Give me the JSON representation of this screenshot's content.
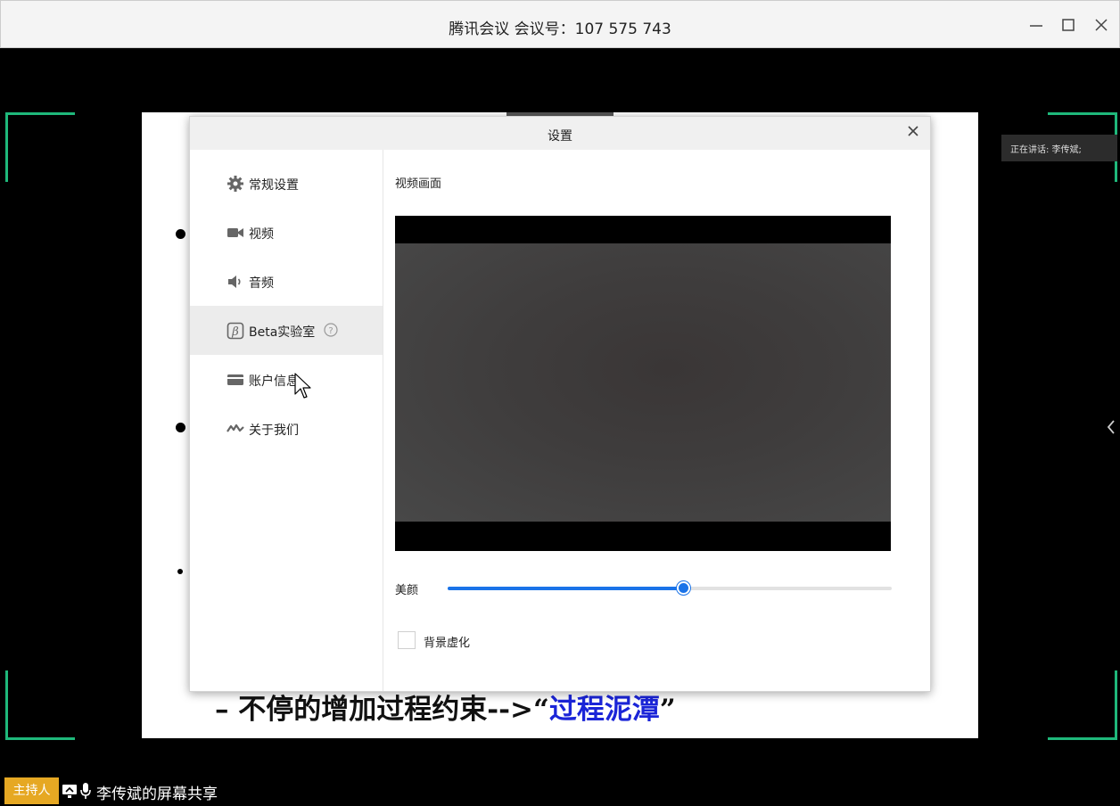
{
  "window": {
    "title": "腾讯会议 会议号：107 575 743"
  },
  "slide": {
    "line_prefix": "– 不停的增加过程约束-->“",
    "line_highlight": "过程泥潭",
    "line_suffix": "”"
  },
  "speaking": {
    "label": "正在讲话: 李传斌;"
  },
  "bottom": {
    "host_badge": "主持人",
    "share_text": "李传斌的屏幕共享"
  },
  "dialog": {
    "title": "设置",
    "nav": [
      {
        "label": "常规设置",
        "icon": "gear-icon"
      },
      {
        "label": "视频",
        "icon": "video-camera-icon"
      },
      {
        "label": "音频",
        "icon": "speaker-icon"
      },
      {
        "label": "Beta实验室",
        "icon": "beta-icon",
        "active": true
      },
      {
        "label": "账户信息",
        "icon": "card-icon"
      },
      {
        "label": "关于我们",
        "icon": "logo-icon"
      }
    ],
    "section_title": "视频画面",
    "beauty_label": "美颜",
    "beauty_level": 0.53,
    "background_blur_label": "背景虚化",
    "background_blur_checked": false
  },
  "colors": {
    "accent": "#1a73e8",
    "frame": "#1fb87b",
    "host_badge": "#e6a823",
    "highlight_text": "#1b25d8"
  }
}
